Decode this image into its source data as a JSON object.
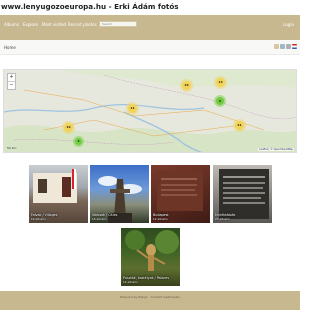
{
  "site": {
    "title": "www.lenyugozoeuropa.hu - Erki Ádám fotós"
  },
  "nav": {
    "items": [
      "Albums",
      "Explore",
      "Most visited",
      "Recent photos"
    ],
    "search_placeholder": "Search",
    "login": "Login"
  },
  "breadcrumb": "Home",
  "toolbar": {
    "icons": [
      "calendar-icon",
      "map-icon",
      "camera-icon",
      "flag-icon"
    ]
  },
  "map": {
    "zoom_in": "+",
    "zoom_out": "−",
    "scale_label": "50 km",
    "attribution": "Leaflet | © OpenStreetMap",
    "clusters": [
      {
        "count": "19",
        "color": "#f1d357"
      },
      {
        "count": "13",
        "color": "#f1d357"
      },
      {
        "count": "11",
        "color": "#f1d357"
      },
      {
        "count": "9",
        "color": "#6ecc3d"
      },
      {
        "count": "16",
        "color": "#f1d357"
      },
      {
        "count": "21",
        "color": "#f1d357"
      },
      {
        "count": "4",
        "color": "#6ecc3d"
      }
    ]
  },
  "albums": [
    {
      "title": "Falvak / Villages",
      "count": "19 albums"
    },
    {
      "title": "Városok / Cities",
      "count": "16 albums"
    },
    {
      "title": "Budapest",
      "count": "12 albums"
    },
    {
      "title": "Emléktáblák",
      "count": "23 albums"
    },
    {
      "title": "Puszták, kastélyok / Palaces",
      "count": "14 albums"
    }
  ],
  "footer": {
    "text": "Powered by Piwigo · Contact webmaster"
  }
}
